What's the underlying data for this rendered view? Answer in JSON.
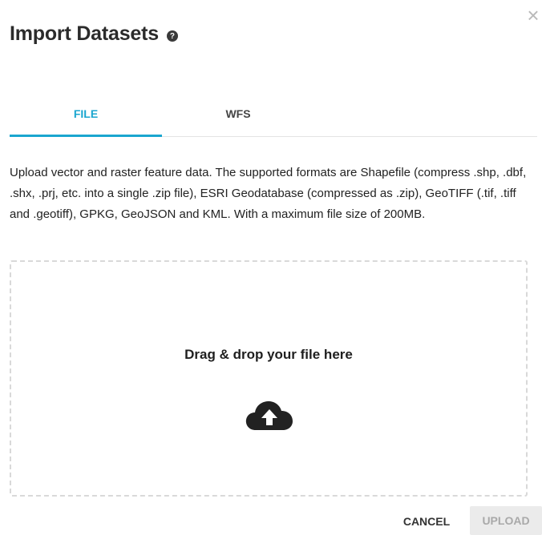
{
  "dialog": {
    "title": "Import Datasets",
    "help_icon": "question-circle-icon",
    "close_icon": "close-icon",
    "close_glyph": "×"
  },
  "tabs": [
    {
      "label": "FILE",
      "active": true
    },
    {
      "label": "WFS",
      "active": false
    }
  ],
  "description": "Upload vector and raster feature data. The supported formats are Shapefile (compress .shp, .dbf, .shx, .prj, etc. into a single .zip file), ESRI Geodatabase (compressed as .zip), GeoTIFF (.tif, .tiff and .geotiff), GPKG, GeoJSON and KML. With a maximum file size of 200MB.",
  "dropzone": {
    "text": "Drag & drop your file here",
    "icon": "cloud-upload-icon"
  },
  "footer": {
    "cancel_label": "CANCEL",
    "upload_label": "UPLOAD",
    "upload_enabled": false
  },
  "colors": {
    "accent": "#1aa6cf",
    "title": "#2b2b2b",
    "disabled_bg": "#ebebeb",
    "disabled_text": "#a9a9a9",
    "dropzone_border": "#d9d9d9"
  }
}
